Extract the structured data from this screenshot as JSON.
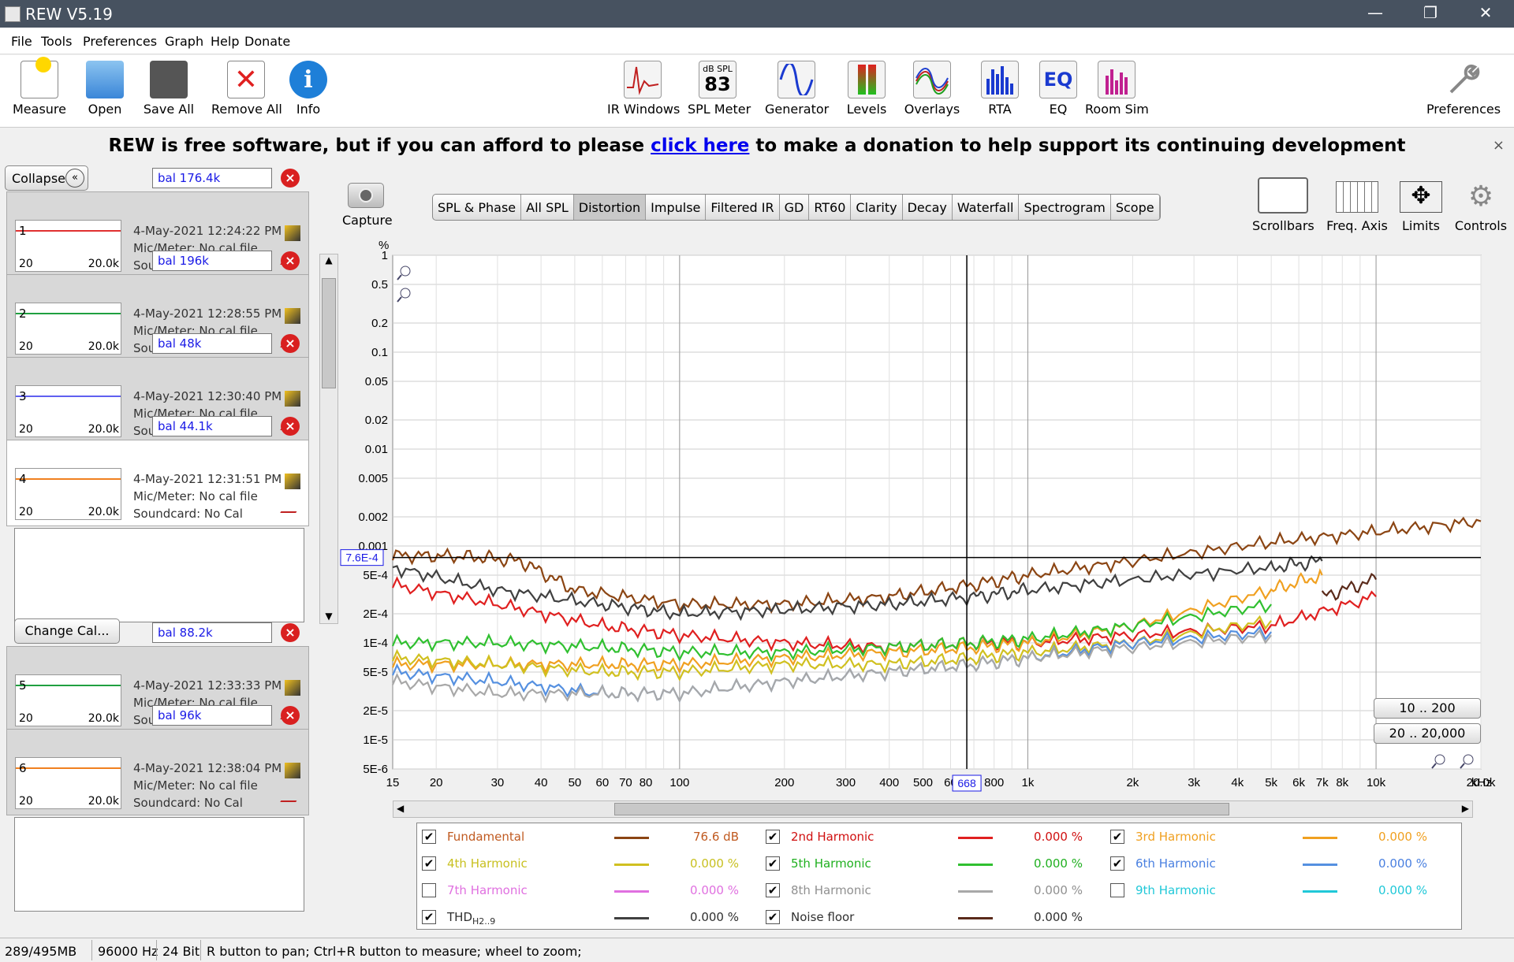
{
  "window": {
    "title": "REW V5.19",
    "minimize": "—",
    "restore": "❐",
    "close": "✕"
  },
  "menu": [
    "File",
    "Tools",
    "Preferences",
    "Graph",
    "Help",
    "Donate"
  ],
  "toolbar": {
    "left": [
      "Measure",
      "Open",
      "Save All",
      "Remove All",
      "Info"
    ],
    "center": [
      "IR Windows",
      "SPL Meter",
      "Generator",
      "Levels",
      "Overlays",
      "RTA",
      "EQ",
      "Room Sim"
    ],
    "spl_icon_top": "dB SPL",
    "spl_icon_value": "83",
    "right": "Preferences"
  },
  "banner": {
    "pre": "REW is free software, but if you can afford to please ",
    "link": "click here",
    "post": " to make a donation to help support its continuing development",
    "close": "×"
  },
  "left": {
    "collapse": "Collapse",
    "change_cal": "Change Cal...",
    "measurements": [
      {
        "num": "1",
        "name": "bal 176.4k",
        "date": "4-May-2021 12:24:22 PM",
        "mic": "Mic/Meter: No cal file",
        "sound": "Soundcard: No Cal",
        "color": "#e03030",
        "lo": "20",
        "hi": "20.0k"
      },
      {
        "num": "2",
        "name": "bal 196k",
        "date": "4-May-2021 12:28:55 PM",
        "mic": "Mic/Meter: No cal file",
        "sound": "Soundcard: No Cal",
        "color": "#20a040",
        "lo": "20",
        "hi": "20.0k"
      },
      {
        "num": "3",
        "name": "bal 48k",
        "date": "4-May-2021 12:30:40 PM",
        "mic": "Mic/Meter: No cal file",
        "sound": "Soundcard: No Cal",
        "color": "#6060f0",
        "lo": "20",
        "hi": "20.0k"
      },
      {
        "num": "4",
        "name": "bal 44.1k",
        "date": "4-May-2021 12:31:51 PM",
        "mic": "Mic/Meter: No cal file",
        "sound": "Soundcard: No Cal",
        "color": "#f08020",
        "lo": "20",
        "hi": "20.0k"
      },
      {
        "num": "5",
        "name": "bal 88.2k",
        "date": "4-May-2021 12:33:33 PM",
        "mic": "Mic/Meter: No cal file",
        "sound": "Soundcard: No Cal",
        "color": "#20a040",
        "lo": "20",
        "hi": "20.0k"
      },
      {
        "num": "6",
        "name": "bal 96k",
        "date": "4-May-2021 12:38:04 PM",
        "mic": "Mic/Meter: No cal file",
        "sound": "Soundcard: No Cal",
        "color": "#f08020",
        "lo": "20",
        "hi": "20.0k"
      }
    ]
  },
  "capture": "Capture",
  "tabs": [
    "SPL & Phase",
    "All SPL",
    "Distortion",
    "Impulse",
    "Filtered IR",
    "GD",
    "RT60",
    "Clarity",
    "Decay",
    "Waterfall",
    "Spectrogram",
    "Scope"
  ],
  "active_tab": "Distortion",
  "right_buttons": [
    "Scrollbars",
    "Freq. Axis",
    "Limits",
    "Controls"
  ],
  "chart_data": {
    "type": "line",
    "yunit": "%",
    "xunit": "kHz",
    "yscale": "log",
    "xscale": "log",
    "ylim": [
      0.0005,
      1
    ],
    "xlim": [
      15,
      20000
    ],
    "y_ticks": [
      "1",
      "0.5",
      "0.2",
      "0.1",
      "0.05",
      "0.02",
      "0.01",
      "0.005",
      "0.002",
      "0.001",
      "5E-4",
      "2E-4",
      "1E-4",
      "5E-5",
      "2E-5",
      "1E-5",
      "5E-6"
    ],
    "x_ticks": [
      "15",
      "20",
      "30",
      "40",
      "50",
      "60",
      "70",
      "80",
      "100",
      "200",
      "300",
      "400",
      "500",
      "60",
      "800",
      "1k",
      "2k",
      "3k",
      "4k",
      "5k",
      "6k",
      "7k",
      "8k",
      "10k",
      "20.0k"
    ],
    "cursor_y_label": "7.6E-4",
    "cursor_x_label": "668",
    "grid": true,
    "series": [
      {
        "name": "Fundamental",
        "color": "#8b4513",
        "x": [
          15,
          25,
          35,
          50,
          100,
          200,
          400,
          700,
          1000,
          2000,
          5000,
          10000,
          20000
        ],
        "y": [
          0.0008,
          0.00078,
          0.0007,
          0.00035,
          0.00025,
          0.00025,
          0.0003,
          0.0004,
          0.0005,
          0.0007,
          0.0011,
          0.0014,
          0.0018
        ]
      },
      {
        "name": "2nd Harmonic",
        "color": "#e02020",
        "x": [
          15,
          30,
          60,
          100,
          200,
          400,
          700,
          1000,
          2000,
          5000,
          10000
        ],
        "y": [
          0.0004,
          0.00025,
          0.00015,
          0.00012,
          0.0001,
          9e-05,
          0.0001,
          0.0001,
          0.00012,
          0.00015,
          0.0003
        ]
      },
      {
        "name": "3rd Harmonic",
        "color": "#f0a020",
        "x": [
          15,
          30,
          60,
          100,
          200,
          400,
          700,
          1000,
          2000,
          5000,
          7000
        ],
        "y": [
          6e-05,
          6e-05,
          6e-05,
          6e-05,
          7e-05,
          8e-05,
          9e-05,
          0.0001,
          0.00015,
          0.00035,
          0.0005
        ]
      },
      {
        "name": "4th Harmonic",
        "color": "#d0c020",
        "x": [
          15,
          30,
          60,
          100,
          200,
          400,
          700,
          1000,
          2000,
          5000
        ],
        "y": [
          7e-05,
          6e-05,
          5e-05,
          5e-05,
          6e-05,
          6e-05,
          7e-05,
          8e-05,
          0.0001,
          0.00017
        ]
      },
      {
        "name": "5th Harmonic",
        "color": "#30c030",
        "x": [
          15,
          30,
          60,
          100,
          200,
          400,
          700,
          1000,
          2000,
          5000
        ],
        "y": [
          0.0001,
          0.0001,
          9e-05,
          8e-05,
          8e-05,
          9e-05,
          0.0001,
          0.00011,
          0.00015,
          0.00025
        ]
      },
      {
        "name": "6th Harmonic",
        "color": "#5590e0",
        "x": [
          15,
          30,
          60,
          100,
          200,
          400,
          700,
          1000,
          2000,
          5000
        ],
        "y": [
          5e-05,
          4e-05,
          3e-05,
          3e-05,
          4e-05,
          5e-05,
          6e-05,
          7e-05,
          0.0001,
          0.00013
        ]
      },
      {
        "name": "8th Harmonic",
        "color": "#a8a8a8",
        "x": [
          15,
          30,
          60,
          100,
          200,
          400,
          700,
          1000,
          2000,
          5000
        ],
        "y": [
          4e-05,
          3e-05,
          3e-05,
          3e-05,
          4e-05,
          5e-05,
          6e-05,
          7e-05,
          9e-05,
          0.00012
        ]
      },
      {
        "name": "THD",
        "color": "#404040",
        "x": [
          15,
          30,
          60,
          100,
          200,
          400,
          700,
          1000,
          2000,
          5000,
          7000
        ],
        "y": [
          0.0006,
          0.00035,
          0.00025,
          0.0002,
          0.00022,
          0.00025,
          0.0003,
          0.00035,
          0.00045,
          0.0006,
          0.0007
        ]
      },
      {
        "name": "Noise floor",
        "color": "#5a2a1a",
        "x": [
          7000,
          10000
        ],
        "y": [
          0.0003,
          0.00045
        ]
      }
    ]
  },
  "range_buttons": [
    "10 .. 200",
    "20 .. 20,000"
  ],
  "legend": [
    {
      "label": "Fundamental",
      "sub": "",
      "color": "#c05a20",
      "value": "76.6 dB",
      "line": "#8b4513",
      "checked": true,
      "col": 0,
      "row": 0
    },
    {
      "label": "2nd Harmonic",
      "sub": "",
      "color": "#d01010",
      "value": "0.000 %",
      "line": "#e02020",
      "checked": true,
      "col": 1,
      "row": 0
    },
    {
      "label": "3rd Harmonic",
      "sub": "",
      "color": "#f0a020",
      "value": "0.000 %",
      "line": "#f0a020",
      "checked": true,
      "col": 2,
      "row": 0
    },
    {
      "label": "4th Harmonic",
      "sub": "",
      "color": "#c8c020",
      "value": "0.000 %",
      "line": "#d0c020",
      "checked": true,
      "col": 0,
      "row": 1
    },
    {
      "label": "5th Harmonic",
      "sub": "",
      "color": "#20b020",
      "value": "0.000 %",
      "line": "#30c030",
      "checked": true,
      "col": 1,
      "row": 1
    },
    {
      "label": "6th Harmonic",
      "sub": "",
      "color": "#4a80e0",
      "value": "0.000 %",
      "line": "#5590e0",
      "checked": true,
      "col": 2,
      "row": 1
    },
    {
      "label": "7th Harmonic",
      "sub": "",
      "color": "#e070e0",
      "value": "0.000 %",
      "line": "#e070e0",
      "checked": false,
      "col": 0,
      "row": 2
    },
    {
      "label": "8th Harmonic",
      "sub": "",
      "color": "#909090",
      "value": "0.000 %",
      "line": "#a8a8a8",
      "checked": true,
      "col": 1,
      "row": 2
    },
    {
      "label": "9th Harmonic",
      "sub": "",
      "color": "#20c8d8",
      "value": "0.000 %",
      "line": "#20c8d8",
      "checked": false,
      "col": 2,
      "row": 2
    },
    {
      "label": "THD",
      "sub": "H2..9",
      "color": "#303030",
      "value": "0.000 %",
      "line": "#404040",
      "checked": true,
      "col": 0,
      "row": 3
    },
    {
      "label": "Noise floor",
      "sub": "",
      "color": "#303030",
      "value": "0.000 %",
      "line": "#5a2a1a",
      "checked": true,
      "col": 1,
      "row": 3
    }
  ],
  "status": {
    "mem": "289/495MB",
    "rate": "96000 Hz",
    "bits": "24 Bit",
    "hint": "R button to pan; Ctrl+R button to measure; wheel to zoom;"
  }
}
